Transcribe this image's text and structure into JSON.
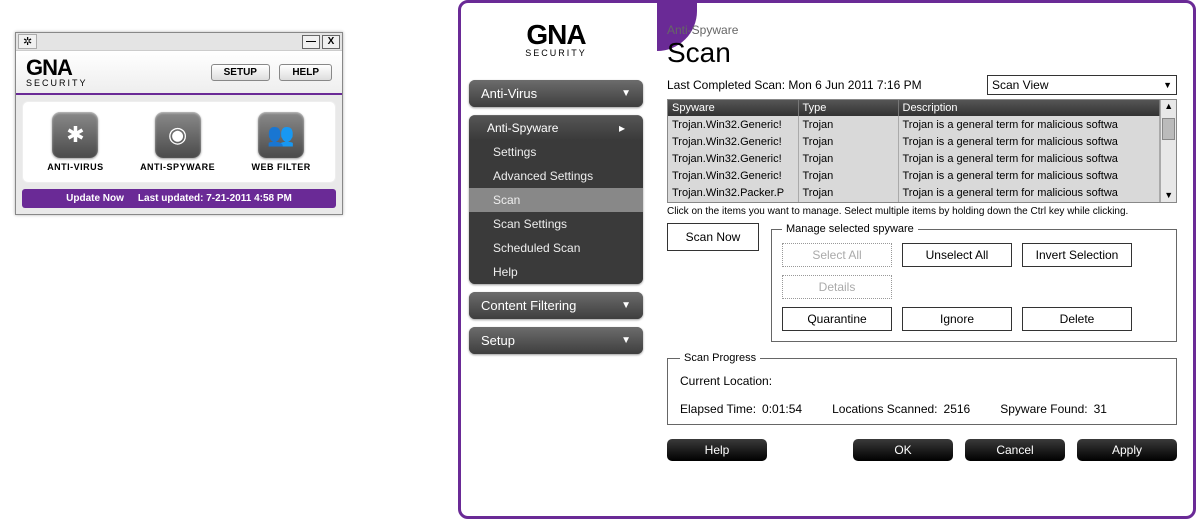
{
  "mini": {
    "logo_main": "GNA",
    "logo_sub": "SECURITY",
    "setup_btn": "SETUP",
    "help_btn": "HELP",
    "tiles": [
      {
        "label": "ANTI-VIRUS"
      },
      {
        "label": "ANTI-SPYWARE"
      },
      {
        "label": "WEB FILTER"
      }
    ],
    "update_now": "Update Now",
    "last_updated_label": "Last updated:",
    "last_updated_value": "7-21-2011 4:58 PM"
  },
  "sidebar": {
    "logo_main": "GNA",
    "logo_sub": "SECURITY",
    "antivirus": "Anti-Virus",
    "antispyware": "Anti-Spyware",
    "sub": {
      "settings": "Settings",
      "advanced": "Advanced Settings",
      "scan": "Scan",
      "scan_settings": "Scan Settings",
      "scheduled": "Scheduled Scan",
      "help": "Help"
    },
    "content_filtering": "Content Filtering",
    "setup": "Setup"
  },
  "page": {
    "crumb": "Anti-Spyware",
    "title": "Scan",
    "last_scan_label": "Last Completed Scan:",
    "last_scan_value": "Mon 6 Jun 2011 7:16 PM",
    "scan_view": "Scan View",
    "columns": {
      "spyware": "Spyware",
      "type": "Type",
      "description": "Description"
    },
    "rows": [
      {
        "spyware": "Trojan.Win32.Generic!",
        "type": "Trojan",
        "desc": "Trojan is a general term for malicious softwa"
      },
      {
        "spyware": "Trojan.Win32.Generic!",
        "type": "Trojan",
        "desc": "Trojan is a general term for malicious softwa"
      },
      {
        "spyware": "Trojan.Win32.Generic!",
        "type": "Trojan",
        "desc": "Trojan is a general term for malicious softwa"
      },
      {
        "spyware": "Trojan.Win32.Generic!",
        "type": "Trojan",
        "desc": "Trojan is a general term for malicious softwa"
      },
      {
        "spyware": "Trojan.Win32.Packer.P",
        "type": "Trojan",
        "desc": "Trojan is a general term for malicious softwa"
      }
    ],
    "hint": "Click on the items you want to manage. Select multiple items by holding down the Ctrl key while clicking.",
    "scan_now": "Scan Now",
    "manage_legend": "Manage selected spyware",
    "btns": {
      "select_all": "Select All",
      "unselect_all": "Unselect All",
      "invert": "Invert Selection",
      "details": "Details",
      "quarantine": "Quarantine",
      "ignore": "Ignore",
      "delete": "Delete"
    },
    "progress_legend": "Scan Progress",
    "current_location_label": "Current Location:",
    "elapsed_label": "Elapsed Time:",
    "elapsed_value": "0:01:54",
    "locations_label": "Locations Scanned:",
    "locations_value": "2516",
    "found_label": "Spyware Found:",
    "found_value": "31",
    "footer": {
      "help": "Help",
      "ok": "OK",
      "cancel": "Cancel",
      "apply": "Apply"
    }
  }
}
